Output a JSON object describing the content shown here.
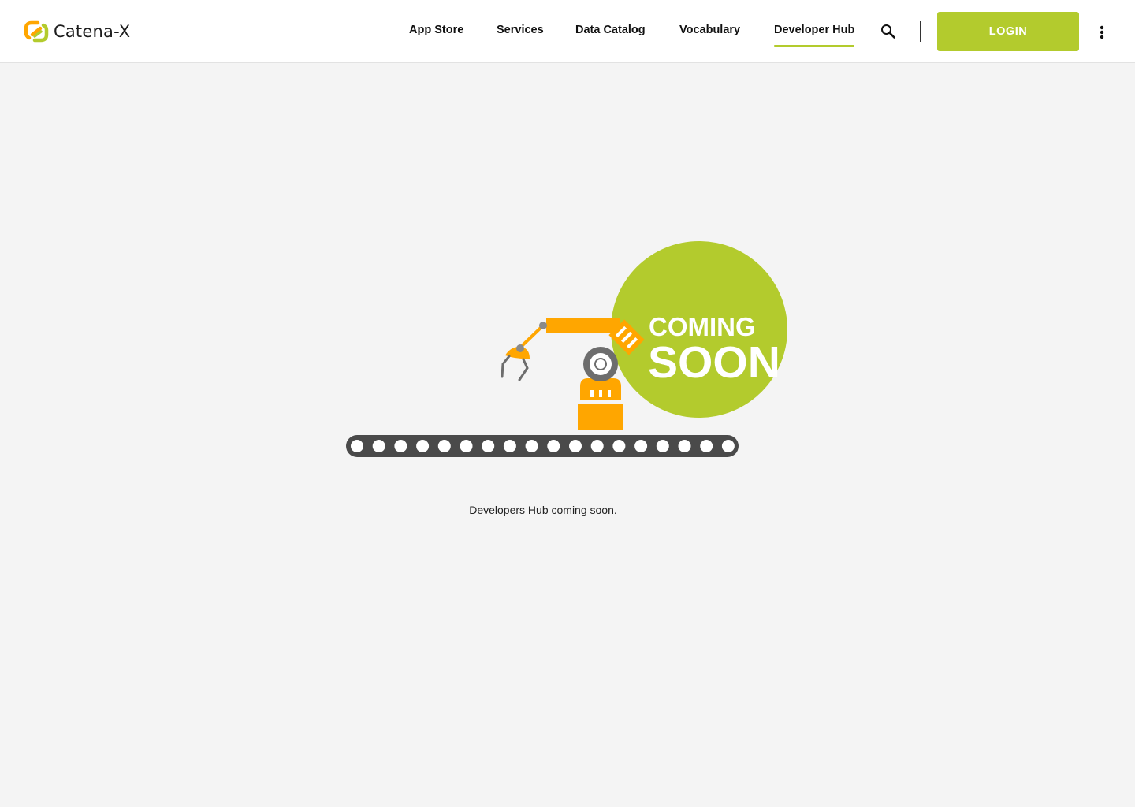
{
  "header": {
    "brand": "Catena-X",
    "nav": [
      {
        "label": "App Store"
      },
      {
        "label": "Services"
      },
      {
        "label": "Data Catalog"
      },
      {
        "label": "Vocabulary"
      },
      {
        "label": "Developer Hub",
        "active": true
      }
    ],
    "search_icon": "search-icon",
    "login_label": "LOGIN",
    "more_icon": "more-vert-icon"
  },
  "main": {
    "badge_line1": "COMING",
    "badge_line2": "SOON",
    "message": "Developers Hub coming soon."
  },
  "colors": {
    "accent": "#b3cb2d",
    "robot": "#ffa600",
    "belt": "#4a4a4a",
    "background": "#f4f4f4"
  }
}
